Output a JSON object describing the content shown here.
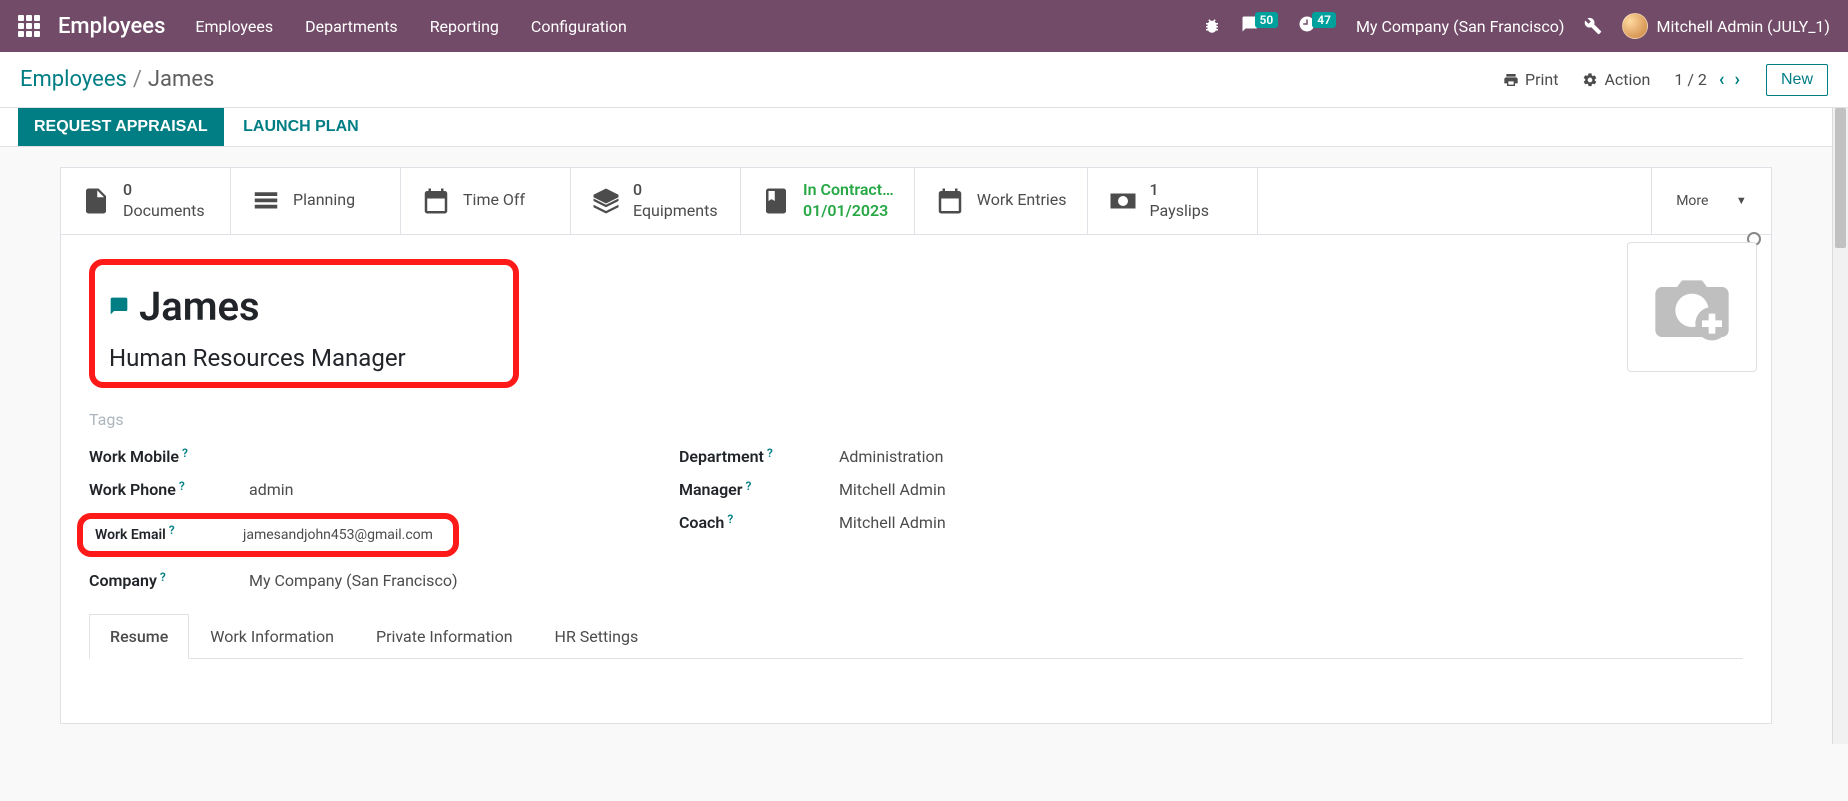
{
  "topbar": {
    "brand": "Employees",
    "menu": [
      "Employees",
      "Departments",
      "Reporting",
      "Configuration"
    ],
    "msg_count": "50",
    "clock_count": "47",
    "company": "My Company (San Francisco)",
    "user": "Mitchell Admin (JULY_1)"
  },
  "subhead": {
    "breadcrumb_root": "Employees",
    "breadcrumb_current": "James",
    "print": "Print",
    "action": "Action",
    "pager": "1 / 2",
    "new": "New"
  },
  "actions": {
    "request_appraisal": "REQUEST APPRAISAL",
    "launch_plan": "LAUNCH PLAN"
  },
  "stats": {
    "documents_count": "0",
    "documents": "Documents",
    "planning": "Planning",
    "timeoff": "Time Off",
    "equip_count": "0",
    "equipments": "Equipments",
    "contract_line1": "In Contract…",
    "contract_line2": "01/01/2023",
    "work_entries": "Work Entries",
    "payslips_count": "1",
    "payslips": "Payslips",
    "more": "More"
  },
  "employee": {
    "name": "James",
    "job_title": "Human Resources Manager",
    "tags_placeholder": "Tags"
  },
  "fields": {
    "work_mobile_l": "Work Mobile",
    "work_mobile_v": "",
    "work_phone_l": "Work Phone",
    "work_phone_v": "admin",
    "work_email_l": "Work Email",
    "work_email_v": "jamesandjohn453@gmail.com",
    "company_l": "Company",
    "company_v": "My Company (San Francisco)",
    "department_l": "Department",
    "department_v": "Administration",
    "manager_l": "Manager",
    "manager_v": "Mitchell Admin",
    "coach_l": "Coach",
    "coach_v": "Mitchell Admin"
  },
  "tabs": [
    "Resume",
    "Work Information",
    "Private Information",
    "HR Settings"
  ]
}
